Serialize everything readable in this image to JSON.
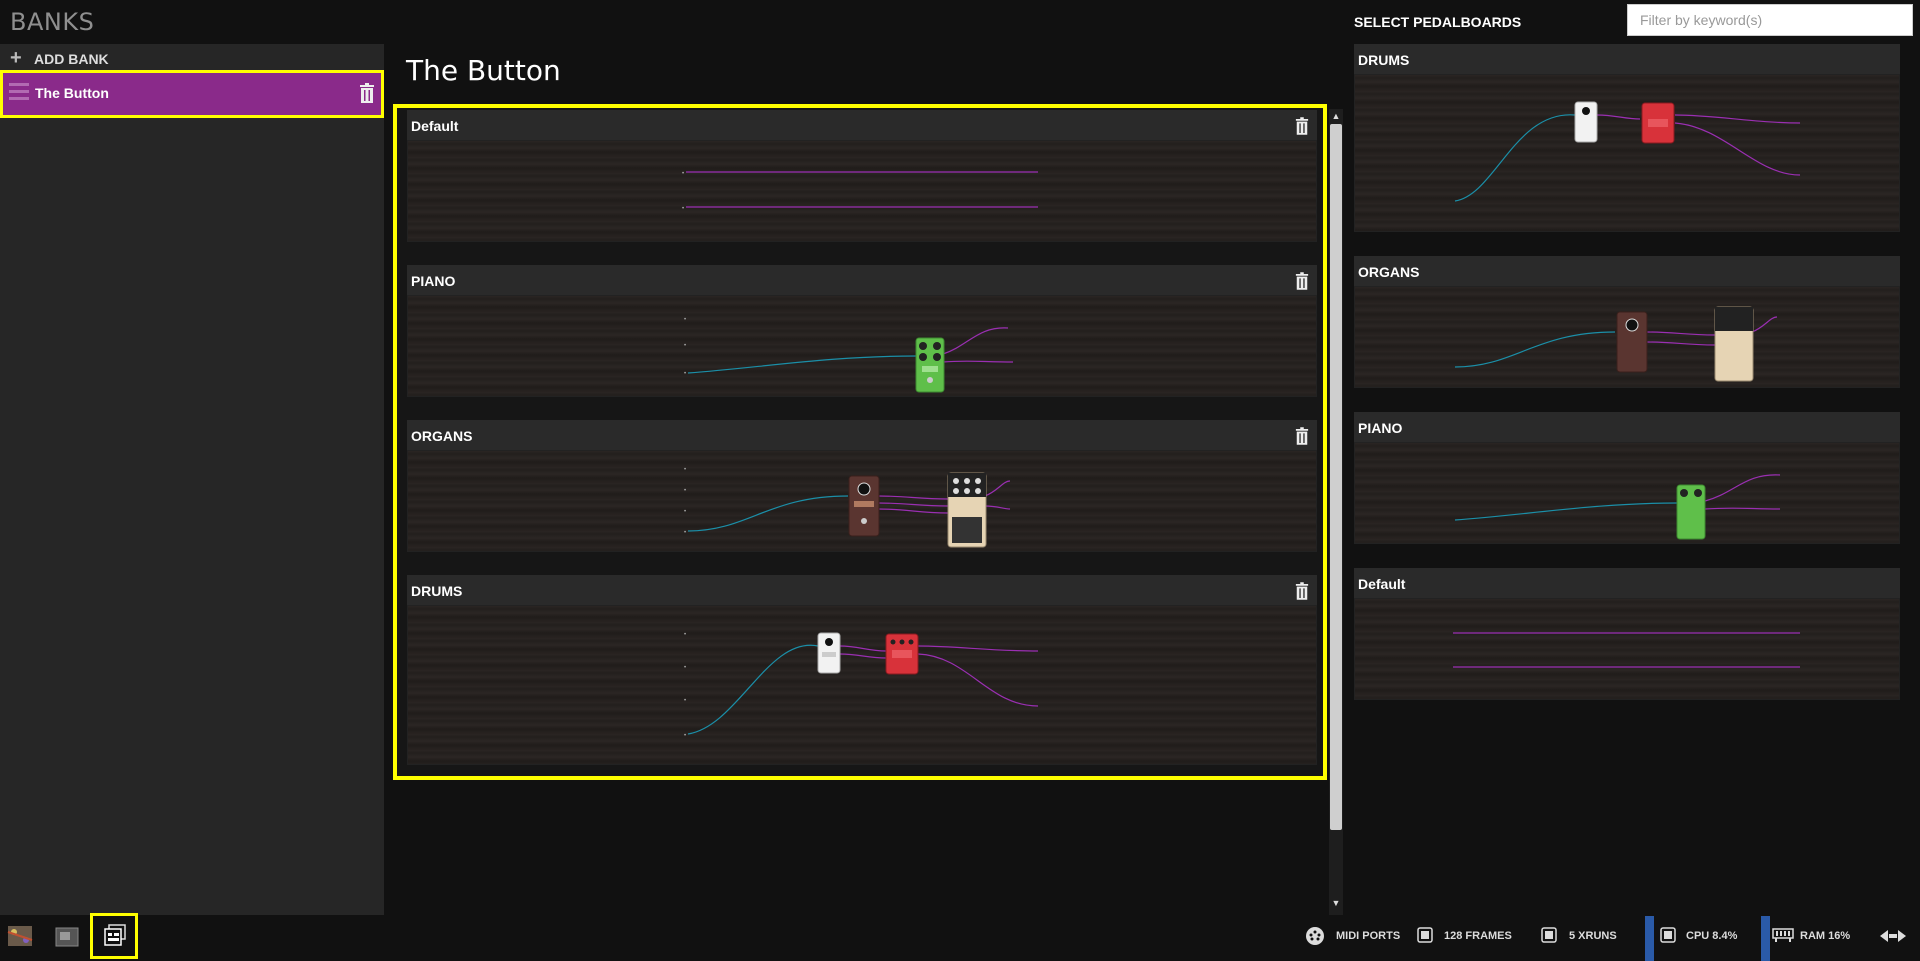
{
  "sidebar": {
    "title": "BANKS",
    "add_bank_label": "ADD BANK",
    "banks": [
      {
        "label": "The Button",
        "selected": true
      }
    ]
  },
  "main": {
    "bank_title": "The Button",
    "pedalboards": [
      {
        "name": "Default"
      },
      {
        "name": "PIANO"
      },
      {
        "name": "ORGANS"
      },
      {
        "name": "DRUMS"
      }
    ]
  },
  "right_panel": {
    "title": "SELECT PEDALBOARDS",
    "filter_placeholder": "Filter by keyword(s)",
    "filter_value": "",
    "pedalboards": [
      {
        "name": "DRUMS"
      },
      {
        "name": "ORGANS"
      },
      {
        "name": "PIANO"
      },
      {
        "name": "Default"
      }
    ]
  },
  "status_bar": {
    "midi_ports": "MIDI PORTS",
    "frames": "128 FRAMES",
    "xruns": "5 XRUNS",
    "cpu": "CPU 8.4%",
    "ram": "RAM 16%"
  },
  "icons": {
    "pedalboard_nav": "pedalboard-icon",
    "file_manager_nav": "file-manager-icon",
    "banks_nav": "banks-icon",
    "trash": "trash-icon",
    "add": "plus-icon",
    "handle": "drag-handle-icon",
    "midi": "midi-icon",
    "chip": "chip-icon",
    "ram": "ram-icon",
    "transport": "transport-icon"
  },
  "colors": {
    "accent": "#ffff00",
    "bank_selected": "#8a2a8a",
    "cable_audio": "#1b8fa8",
    "cable_midi": "#9a2fb2",
    "status_blue": "#2a5aa8"
  }
}
